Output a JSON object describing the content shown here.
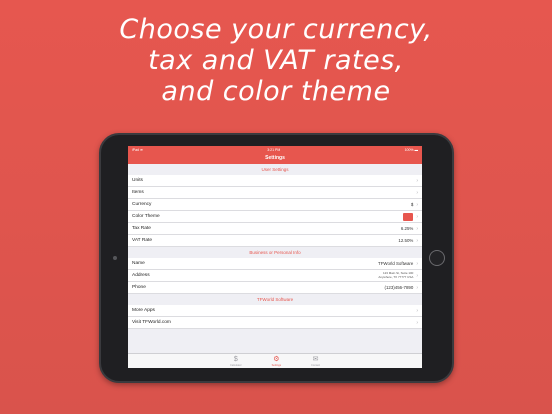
{
  "headline": {
    "line1": "Choose your currency,",
    "line2": "tax and VAT rates,",
    "line3": "and color theme"
  },
  "status": {
    "carrier": "iPad ≋",
    "time": "3:21 PM",
    "battery": "100% ▬"
  },
  "nav": {
    "title": "Settings"
  },
  "sections": {
    "user": "User Settings",
    "business": "Business or Personal Info",
    "company": "TFWorld Software"
  },
  "user_rows": {
    "units": "Units",
    "items": "Items",
    "currency": "Currency",
    "currency_value": "$",
    "color_theme": "Color Theme",
    "tax_rate": "Tax Rate",
    "tax_rate_value": "6.25%",
    "vat_rate": "VAT Rate",
    "vat_rate_value": "12.50%"
  },
  "business_rows": {
    "name": "Name",
    "name_value": "TFWorld Software",
    "address": "Address",
    "address_line1": "123 Main St, Suite 100",
    "address_line2": "Anywhere, TX 77777 USA",
    "phone": "Phone",
    "phone_value": "(123)456-7890"
  },
  "company_rows": {
    "more_apps": "More Apps",
    "visit": "Visit TFWorld.com"
  },
  "tabs": {
    "calculator": "Calculator",
    "settings": "Settings",
    "contact": "Contact"
  },
  "colors": {
    "accent": "#e7564e",
    "background": "#d9534c"
  },
  "icons": {
    "chevron": "chevron-right-icon",
    "calculator": "dollar-icon",
    "settings": "gear-icon",
    "contact": "envelope-icon"
  }
}
